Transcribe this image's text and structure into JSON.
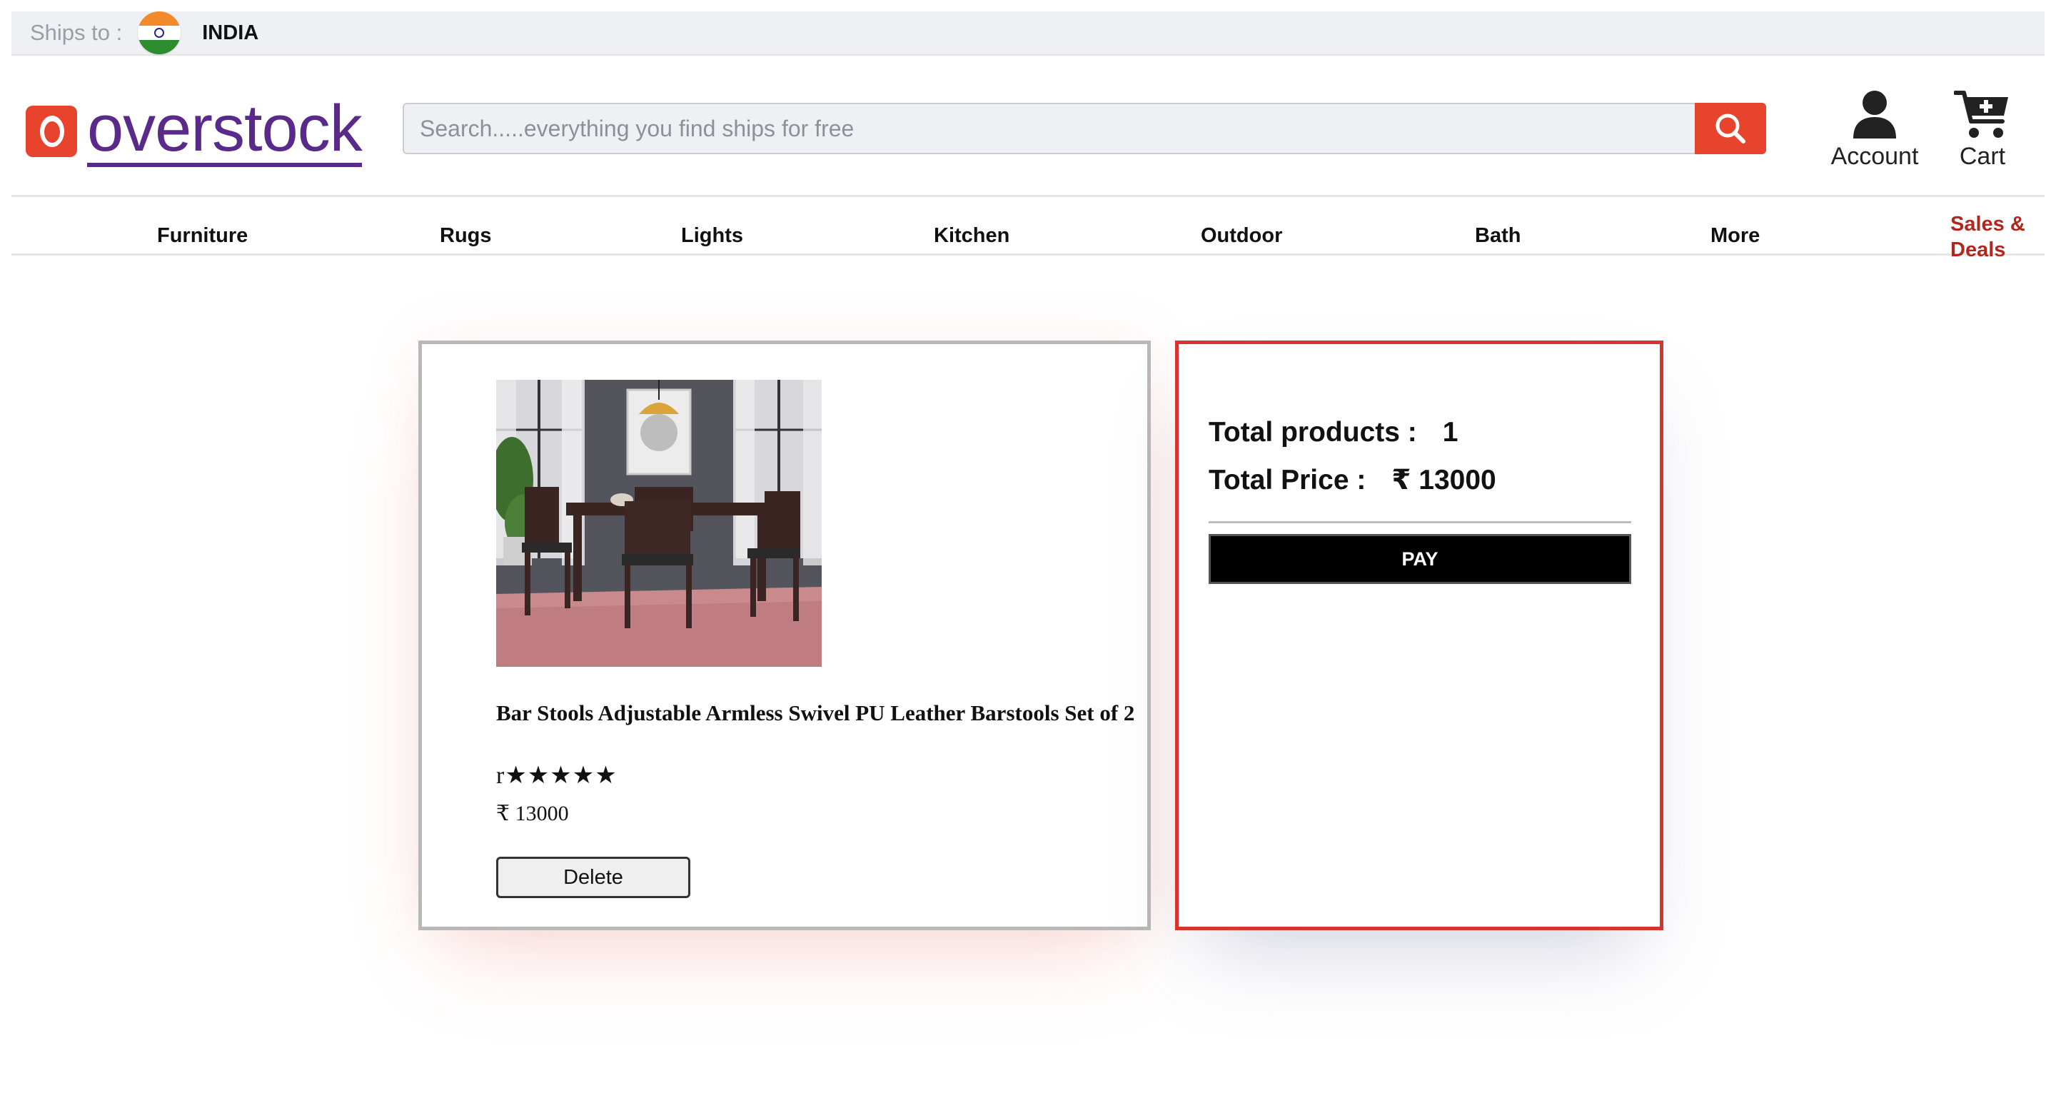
{
  "ships": {
    "label": "Ships to :",
    "country": "INDIA"
  },
  "header": {
    "logo_text": "overstock",
    "search_placeholder": "Search.....everything you find ships for free",
    "account_label": "Account",
    "cart_label": "Cart"
  },
  "nav": {
    "items": [
      "Furniture",
      "Rugs",
      "Lights",
      "Kitchen",
      "Outdoor",
      "Bath",
      "More"
    ],
    "deals": "Sales & Deals"
  },
  "cart": {
    "items": [
      {
        "title": "Bar Stools Adjustable Armless Swivel PU Leather Barstools Set of 2",
        "rating_text": "r★★★★★",
        "price": "₹ 13000",
        "delete_label": "Delete"
      }
    ]
  },
  "summary": {
    "products_label": "Total products :",
    "products_value": "1",
    "price_label": "Total Price :",
    "price_value": "₹ 13000",
    "pay_label": "PAY"
  },
  "colors": {
    "brand_red": "#e8432d",
    "brand_purple": "#5a2a8a",
    "deals_red": "#b3261e",
    "summary_border": "#d6342c"
  }
}
